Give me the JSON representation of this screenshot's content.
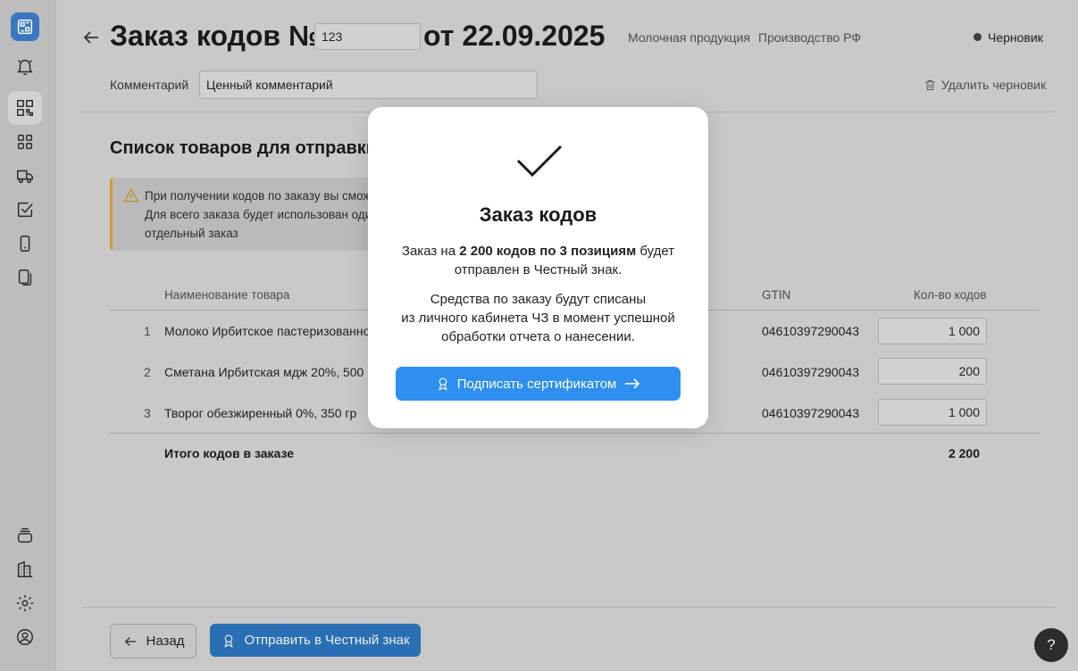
{
  "header": {
    "title_prefix": "Заказ кодов №",
    "order_number": "123",
    "title_date": "от 22.09.2025",
    "category": "Молочная продукция",
    "origin": "Производство РФ",
    "status": "Черновик"
  },
  "comment": {
    "label": "Комментарий",
    "value": "Ценный комментарий"
  },
  "actions": {
    "delete_draft": "Удалить черновик"
  },
  "section": {
    "title": "Список товаров для отправки в"
  },
  "warning": {
    "line1": "При получении кодов по заказу вы сможе",
    "line2": "Для всего заказа будет использован оди",
    "line3": "отдельный заказ"
  },
  "table": {
    "headers": {
      "name": "Наименование товара",
      "gtin": "GTIN",
      "qty": "Кол-во кодов"
    },
    "rows": [
      {
        "num": "1",
        "name": "Молоко Ирбитское пастеризованное",
        "gtin": "04610397290043",
        "qty": "1 000"
      },
      {
        "num": "2",
        "name": "Сметана Ирбитская мдж 20%, 500 гр",
        "gtin": "04610397290043",
        "qty": "200"
      },
      {
        "num": "3",
        "name": "Творог обезжиренный 0%, 350 гр",
        "gtin": "04610397290043",
        "qty": "1 000"
      }
    ],
    "total_label": "Итого кодов в заказе",
    "total_value": "2 200"
  },
  "footer": {
    "back": "Назад",
    "send": "Отправить в Честный знак",
    "help": "?"
  },
  "modal": {
    "title": "Заказ кодов",
    "p1_before": "Заказ на ",
    "p1_bold": "2 200 кодов по 3 позициям",
    "p1_after": " будет отправлен в Честный знак.",
    "p2_line1": "Средства по заказу будут списаны",
    "p2_line2": "из личного кабинета ЧЗ в момент успешной",
    "p2_line3": "обработки отчета о нанесении.",
    "button": "Подписать сертификатом"
  },
  "colors": {
    "primary": "#2f8ff0",
    "overlay_dimmed_primary": "#2a6fb3",
    "warning_accent": "#d59a2e"
  },
  "icons": {
    "sidebar": [
      "qr-logo-icon",
      "bell-icon",
      "qr-code-icon",
      "grid-icon",
      "truck-icon",
      "check-square-icon",
      "phone-icon",
      "pages-icon",
      "stack-icon",
      "buildings-icon",
      "gear-icon",
      "user-circle-icon"
    ]
  }
}
